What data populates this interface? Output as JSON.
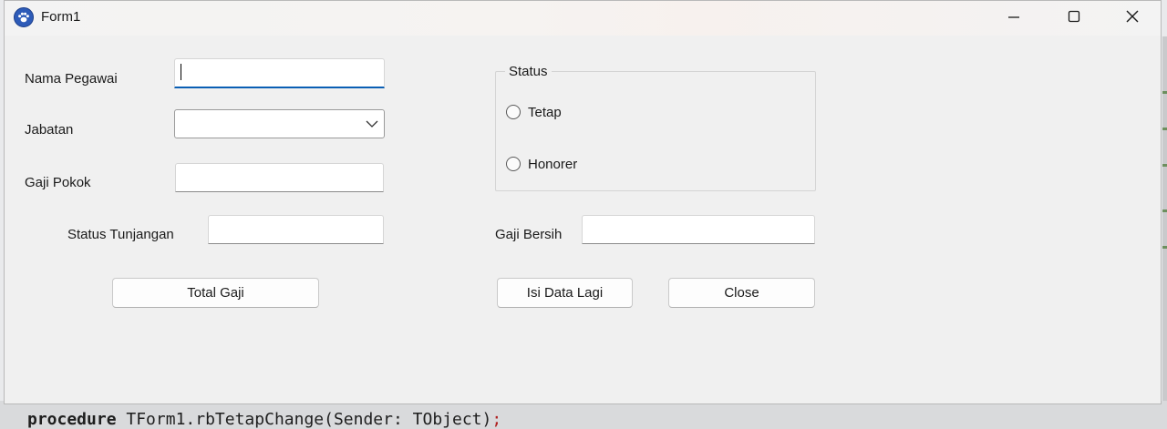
{
  "window": {
    "title": "Form1"
  },
  "form": {
    "nama_pegawai_label": "Nama Pegawai",
    "nama_pegawai_value": "",
    "jabatan_label": "Jabatan",
    "jabatan_value": "",
    "gaji_pokok_label": "Gaji Pokok",
    "gaji_pokok_value": "",
    "status_tunjangan_label": "Status Tunjangan",
    "status_tunjangan_value": "",
    "gaji_bersih_label": "Gaji Bersih",
    "gaji_bersih_value": ""
  },
  "status_group": {
    "title": "Status",
    "options": [
      {
        "label": "Tetap",
        "checked": false
      },
      {
        "label": "Honorer",
        "checked": false
      }
    ]
  },
  "buttons": {
    "total_gaji": "Total Gaji",
    "isi_data_lagi": "Isi Data Lagi",
    "close": "Close"
  },
  "background_code": {
    "keyword": "procedure",
    "text": " TForm1.rbTetapChange(Sender: TObject)",
    "punct": ";"
  },
  "icons": {
    "app": "paw-app-icon",
    "minimize": "minimize-icon",
    "maximize": "maximize-icon",
    "close": "close-icon",
    "dropdown": "chevron-down-icon"
  },
  "colors": {
    "focus_accent": "#0a5fb4",
    "window_bg": "#f0f0f0"
  }
}
